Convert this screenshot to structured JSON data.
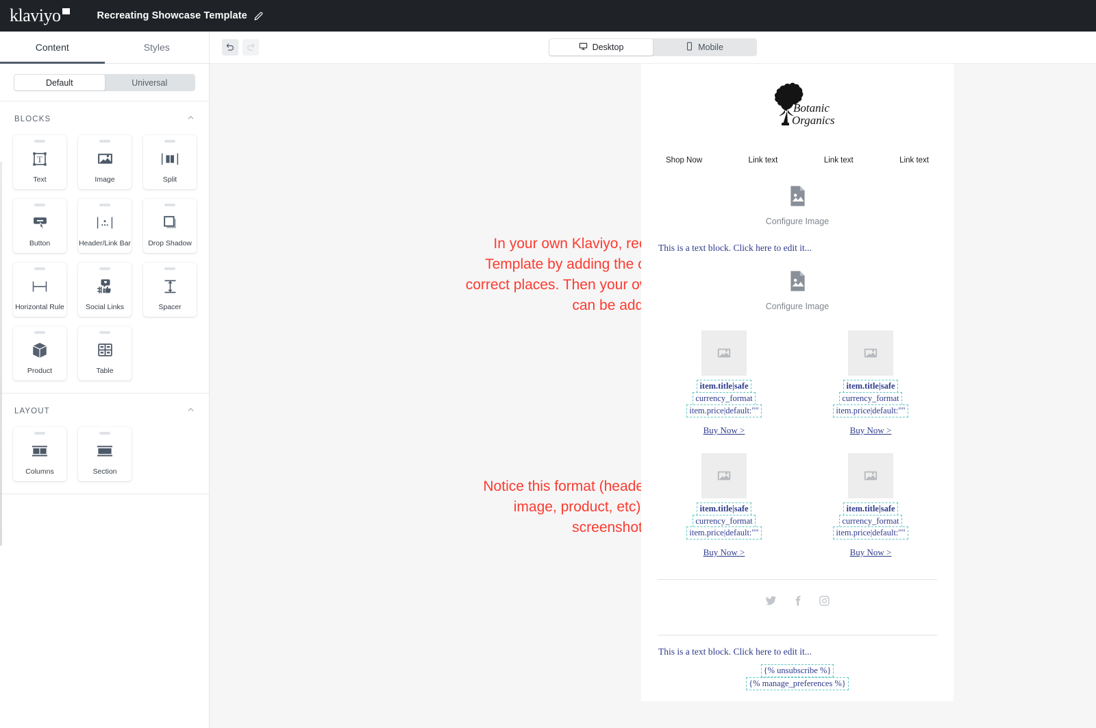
{
  "topbar": {
    "brand": "klaviyo",
    "doc_title": "Recreating Showcase Template",
    "edit_icon": "pencil-icon"
  },
  "left_panel": {
    "tabs": [
      {
        "label": "Content",
        "active": true
      },
      {
        "label": "Styles",
        "active": false
      }
    ],
    "segmented": [
      {
        "label": "Default",
        "active": true
      },
      {
        "label": "Universal",
        "active": false
      }
    ],
    "sections": [
      {
        "label": "BLOCKS",
        "collapse_icon": "chevron-up-icon",
        "items": [
          {
            "label": "Text",
            "icon": "text-block-icon"
          },
          {
            "label": "Image",
            "icon": "image-icon"
          },
          {
            "label": "Split",
            "icon": "split-icon"
          },
          {
            "label": "Button",
            "icon": "button-icon"
          },
          {
            "label": "Header/Link Bar",
            "icon": "header-link-bar-icon"
          },
          {
            "label": "Drop Shadow",
            "icon": "drop-shadow-icon"
          },
          {
            "label": "Horizontal Rule",
            "icon": "horizontal-rule-icon"
          },
          {
            "label": "Social Links",
            "icon": "social-links-icon"
          },
          {
            "label": "Spacer",
            "icon": "spacer-icon"
          },
          {
            "label": "Product",
            "icon": "product-box-icon"
          },
          {
            "label": "Table",
            "icon": "table-icon"
          }
        ]
      },
      {
        "label": "LAYOUT",
        "collapse_icon": "chevron-up-icon",
        "items": [
          {
            "label": "Columns",
            "icon": "columns-icon"
          },
          {
            "label": "Section",
            "icon": "section-icon"
          }
        ]
      }
    ]
  },
  "toolbar": {
    "undo_icon": "undo-icon",
    "redo_icon": "redo-icon",
    "devices": [
      {
        "label": "Desktop",
        "icon": "monitor-icon",
        "active": true
      },
      {
        "label": "Mobile",
        "icon": "phone-icon",
        "active": false
      }
    ]
  },
  "annotations": {
    "color": "#fb3b30",
    "note_1": "In your own Klaviyo, recreated Showcase Template by adding the correct blocks in the correct places. Then your own colors/copy/images can be added in.",
    "note_2": "Notice this format (header link bar, image, text, image, product, etc) matches the first screenshot’s notes"
  },
  "email": {
    "logo_alt": "Botanic Organics",
    "logo_line_1": "Botanic",
    "logo_line_2": "Organics",
    "links": [
      "Shop Now",
      "Link text",
      "Link text",
      "Link text"
    ],
    "image_blocks": [
      {
        "label": "Configure Image",
        "icon": "image-placeholder-icon"
      },
      {
        "label": "Configure Image",
        "icon": "image-placeholder-icon"
      }
    ],
    "text_block_1": "This is a text block. Click here to edit it...",
    "products": [
      {
        "title_tag": "item.title|safe",
        "currency_tag": "currency_format",
        "price_tag": "item.price|default:\"\"",
        "cta": "Buy Now >"
      },
      {
        "title_tag": "item.title|safe",
        "currency_tag": "currency_format",
        "price_tag": "item.price|default:\"\"",
        "cta": "Buy Now >"
      },
      {
        "title_tag": "item.title|safe",
        "currency_tag": "currency_format",
        "price_tag": "item.price|default:\"\"",
        "cta": "Buy Now >"
      },
      {
        "title_tag": "item.title|safe",
        "currency_tag": "currency_format",
        "price_tag": "item.price|default:\"\"",
        "cta": "Buy Now >"
      }
    ],
    "social_icons": [
      "twitter-icon",
      "facebook-icon",
      "instagram-icon"
    ],
    "footer_text": "This is a text block. Click here to edit it...",
    "unsubscribe_tag": "{% unsubscribe %}",
    "manage_preferences_tag": "{% manage_preferences %}"
  }
}
